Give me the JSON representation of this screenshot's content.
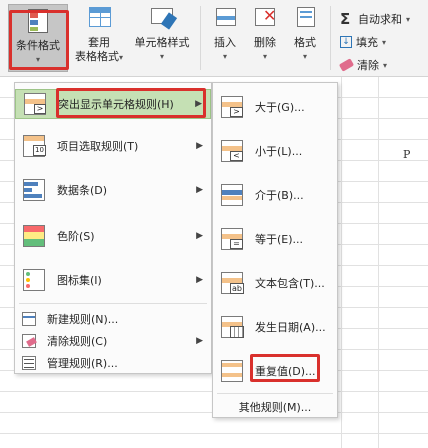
{
  "ribbon": {
    "conditional_format": {
      "line1": "条件格式",
      "caret": "▾"
    },
    "table_format": {
      "line1": "套用",
      "line2": "表格格式",
      "caret": "▾"
    },
    "cell_style": {
      "line1": "单元格样式",
      "caret": "▾"
    },
    "insert": {
      "label": "插入",
      "caret": "▾"
    },
    "delete": {
      "label": "删除",
      "caret": "▾"
    },
    "format": {
      "label": "格式",
      "caret": "▾"
    },
    "autosum": {
      "glyph": "Σ",
      "label": "自动求和",
      "caret": "▾"
    },
    "fill": {
      "label": "填充",
      "caret": "▾"
    },
    "clear": {
      "label": "清除",
      "caret": "▾"
    }
  },
  "sheet": {
    "column_p": "P"
  },
  "menu1": {
    "items": [
      {
        "label": "突出显示单元格规则(H)",
        "arrow": "▶",
        "icon": "highlight-rules-icon"
      },
      {
        "label": "项目选取规则(T)",
        "arrow": "▶",
        "icon": "top-bottom-rules-icon"
      },
      {
        "label": "数据条(D)",
        "arrow": "▶",
        "icon": "data-bars-icon"
      },
      {
        "label": "色阶(S)",
        "arrow": "▶",
        "icon": "color-scales-icon"
      },
      {
        "label": "图标集(I)",
        "arrow": "▶",
        "icon": "icon-sets-icon"
      },
      {
        "label": "新建规则(N)...",
        "icon": "new-rule-icon"
      },
      {
        "label": "清除规则(C)",
        "arrow": "▶",
        "icon": "clear-rules-icon"
      },
      {
        "label": "管理规则(R)...",
        "icon": "manage-rules-icon"
      }
    ]
  },
  "menu2": {
    "items": [
      {
        "label": "大于(G)...",
        "icon": "greater-than-icon"
      },
      {
        "label": "小于(L)...",
        "icon": "less-than-icon"
      },
      {
        "label": "介于(B)...",
        "icon": "between-icon"
      },
      {
        "label": "等于(E)...",
        "icon": "equal-to-icon"
      },
      {
        "label": "文本包含(T)...",
        "icon": "text-contains-icon"
      },
      {
        "label": "发生日期(A)...",
        "icon": "date-occurring-icon"
      },
      {
        "label": "重复值(D)...",
        "icon": "duplicate-values-icon"
      }
    ],
    "other": "其他规则(M)..."
  },
  "colors": {
    "highlight": "#c5e0b4",
    "outline_red": "#d9302c",
    "accent_blue": "#2e75b6"
  }
}
